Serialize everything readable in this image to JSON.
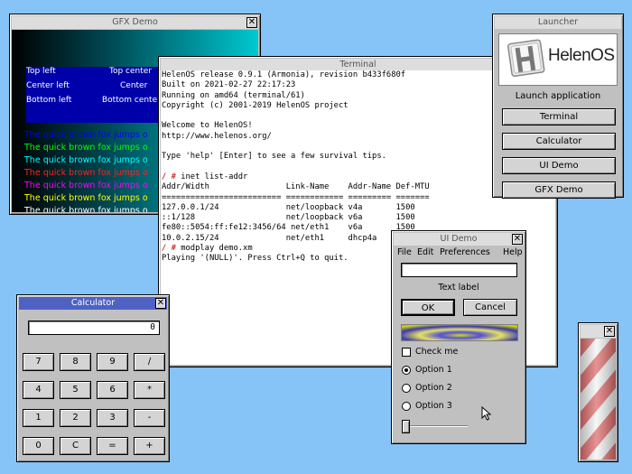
{
  "desktop": {
    "background": "#86c3f7"
  },
  "gfx_demo": {
    "title": "GFX Demo",
    "labels": {
      "top_left": "Top left",
      "top_center": "Top center",
      "center_left": "Center left",
      "center": "Center",
      "bottom_left": "Bottom left",
      "bottom_center": "Bottom cente"
    },
    "fox_lines": [
      {
        "text": "The quick brown fox jumps o",
        "color": "#0000ff"
      },
      {
        "text": "The quick brown fox jumps o",
        "color": "#00ff00"
      },
      {
        "text": "The quick brown fox jumps o",
        "color": "#00ffff"
      },
      {
        "text": "The quick brown fox jumps o",
        "color": "#ff2020"
      },
      {
        "text": "The quick brown fox jumps o",
        "color": "#ff00ff"
      },
      {
        "text": "The quick brown fox jumps o",
        "color": "#ffff00"
      },
      {
        "text": "The quick brown fox jumps o",
        "color": "#ffffff"
      }
    ]
  },
  "terminal": {
    "title": "Terminal",
    "lines": [
      {
        "text": "HelenOS release 0.9.1 (Armonia), revision b433f680f"
      },
      {
        "text": "Built on 2021-02-27 22:17:23"
      },
      {
        "text": "Running on amd64 (terminal/61)"
      },
      {
        "text": "Copyright (c) 2001-2019 HelenOS project"
      },
      {
        "text": ""
      },
      {
        "text": "Welcome to HelenOS!"
      },
      {
        "text": "http://www.helenos.org/"
      },
      {
        "text": ""
      },
      {
        "text": "Type 'help' [Enter] to see a few survival tips."
      },
      {
        "text": ""
      },
      {
        "prompt": "/ # ",
        "text": "inet list-addr"
      },
      {
        "text": "Addr/Width                Link-Name    Addr-Name Def-MTU"
      },
      {
        "text": "========================= ============ ========= ======="
      },
      {
        "text": "127.0.0.1/24              net/loopback v4a       1500"
      },
      {
        "text": "::1/128                   net/loopback v6a       1500"
      },
      {
        "text": "fe80::5054:ff:fe12:3456/64 net/eth1    v6a       1500"
      },
      {
        "text": "10.0.2.15/24              net/eth1     dhcp4a    1500"
      },
      {
        "prompt": "/ # ",
        "text": "modplay demo.xm"
      },
      {
        "text": "Playing '(NULL)'. Press Ctrl+Q to quit."
      }
    ]
  },
  "launcher": {
    "title": "Launcher",
    "logo_text": "HelenOS",
    "launch_label": "Launch application",
    "buttons": [
      "Terminal",
      "Calculator",
      "UI Demo",
      "GFX Demo"
    ]
  },
  "calculator": {
    "title": "Calculator",
    "display": "0",
    "keys": [
      [
        "7",
        "8",
        "9",
        "/"
      ],
      [
        "4",
        "5",
        "6",
        "*"
      ],
      [
        "1",
        "2",
        "3",
        "-"
      ],
      [
        "0",
        "C",
        "=",
        "+"
      ]
    ]
  },
  "ui_demo": {
    "title": "UI Demo",
    "menu": [
      "File",
      "Edit",
      "Preferences",
      "Help"
    ],
    "entry_value": "",
    "text_label": "Text label",
    "ok_label": "OK",
    "cancel_label": "Cancel",
    "checkbox_label": "Check me",
    "checkbox_checked": false,
    "options": [
      "Option 1",
      "Option 2",
      "Option 3"
    ],
    "selected_option": 0,
    "slider_value": 0
  },
  "colors": {
    "active_title": "#4f62c4",
    "window_face": "#c0c0c0",
    "prompt": "#c00000"
  }
}
